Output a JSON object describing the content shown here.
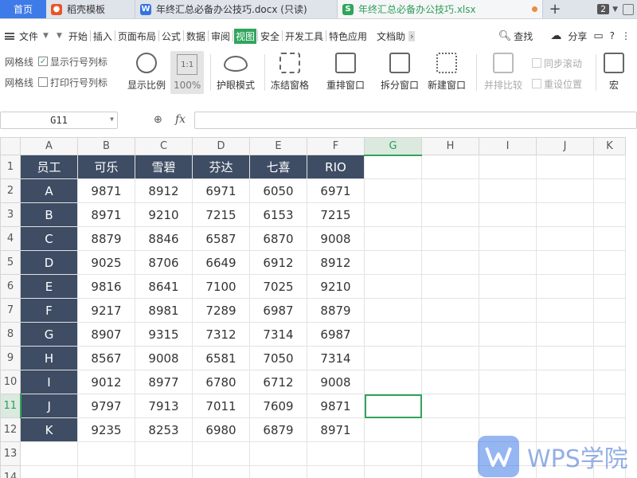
{
  "tabs": {
    "home": "首页",
    "items": [
      {
        "label": "稻壳模板",
        "icon": "daoke-icon"
      },
      {
        "label": "年终汇总必备办公技巧.docx (只读)",
        "icon": "word-doc-icon"
      },
      {
        "label": "年终汇总必备办公技巧.xlsx",
        "icon": "spreadsheet-icon"
      }
    ],
    "add": "+",
    "count": "2"
  },
  "menu": {
    "file": "文件",
    "items": [
      "开始",
      "插入",
      "页面布局",
      "公式",
      "数据",
      "审阅",
      "视图",
      "安全",
      "开发工具",
      "特色应用",
      "文档助"
    ],
    "active": "视图",
    "search": "查找",
    "share": "分享",
    "more_glyph": "›",
    "help": "?",
    "kebab": "⋮"
  },
  "ribbon": {
    "check_gridlines": "网格线",
    "check_show_headers": "显示行号列标",
    "check_print_gridlines": "网格线",
    "check_print_headers": "打印行号列标",
    "zoom_label": "显示比例",
    "zoom_100": "100%",
    "zoom_100_glyph": "1:1",
    "eye_mode": "护眼模式",
    "freeze": "冻结窗格",
    "rearrange": "重排窗口",
    "split": "拆分窗口",
    "new_window": "新建窗口",
    "side_by_side": "并排比较",
    "sync_scroll": "同步滚动",
    "reset_position": "重设位置",
    "macro": "宏"
  },
  "formula_bar": {
    "cell_ref": "G11",
    "fx": "fx",
    "value": ""
  },
  "sheet": {
    "columns": [
      "A",
      "B",
      "C",
      "D",
      "E",
      "F",
      "G",
      "H",
      "I",
      "J",
      "K"
    ],
    "rows": [
      "1",
      "2",
      "3",
      "4",
      "5",
      "6",
      "7",
      "8",
      "9",
      "10",
      "11",
      "12",
      "13",
      "14"
    ],
    "selected_col": "G",
    "selected_row": "11",
    "header": [
      "员工",
      "可乐",
      "雪碧",
      "芬达",
      "七喜",
      "RIO"
    ],
    "data": [
      [
        "A",
        "9871",
        "8912",
        "6971",
        "6050",
        "6971"
      ],
      [
        "B",
        "8971",
        "9210",
        "7215",
        "6153",
        "7215"
      ],
      [
        "C",
        "8879",
        "8846",
        "6587",
        "6870",
        "9008"
      ],
      [
        "D",
        "9025",
        "8706",
        "6649",
        "6912",
        "8912"
      ],
      [
        "E",
        "9816",
        "8641",
        "7100",
        "7025",
        "9210"
      ],
      [
        "F",
        "9217",
        "8981",
        "7289",
        "6987",
        "8879"
      ],
      [
        "G",
        "8907",
        "9315",
        "7312",
        "7314",
        "6987"
      ],
      [
        "H",
        "8567",
        "9008",
        "6581",
        "7050",
        "7314"
      ],
      [
        "I",
        "9012",
        "8977",
        "6780",
        "6712",
        "9008"
      ],
      [
        "J",
        "9797",
        "7913",
        "7011",
        "7609",
        "9871"
      ],
      [
        "K",
        "9235",
        "8253",
        "6980",
        "6879",
        "8971"
      ]
    ],
    "header_color": "#3e4c64",
    "accent_color": "#2fa55c"
  },
  "watermark": {
    "text": "WPS学院"
  }
}
